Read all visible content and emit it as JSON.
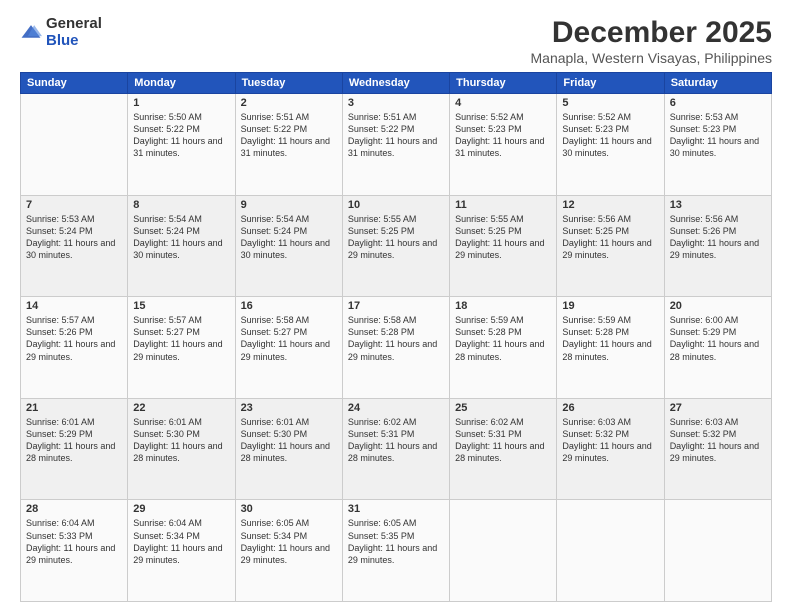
{
  "logo": {
    "general": "General",
    "blue": "Blue"
  },
  "title": {
    "month_year": "December 2025",
    "location": "Manapla, Western Visayas, Philippines"
  },
  "days_of_week": [
    "Sunday",
    "Monday",
    "Tuesday",
    "Wednesday",
    "Thursday",
    "Friday",
    "Saturday"
  ],
  "weeks": [
    [
      {
        "day": "",
        "sunrise": "",
        "sunset": "",
        "daylight": ""
      },
      {
        "day": "1",
        "sunrise": "Sunrise: 5:50 AM",
        "sunset": "Sunset: 5:22 PM",
        "daylight": "Daylight: 11 hours and 31 minutes."
      },
      {
        "day": "2",
        "sunrise": "Sunrise: 5:51 AM",
        "sunset": "Sunset: 5:22 PM",
        "daylight": "Daylight: 11 hours and 31 minutes."
      },
      {
        "day": "3",
        "sunrise": "Sunrise: 5:51 AM",
        "sunset": "Sunset: 5:22 PM",
        "daylight": "Daylight: 11 hours and 31 minutes."
      },
      {
        "day": "4",
        "sunrise": "Sunrise: 5:52 AM",
        "sunset": "Sunset: 5:23 PM",
        "daylight": "Daylight: 11 hours and 31 minutes."
      },
      {
        "day": "5",
        "sunrise": "Sunrise: 5:52 AM",
        "sunset": "Sunset: 5:23 PM",
        "daylight": "Daylight: 11 hours and 30 minutes."
      },
      {
        "day": "6",
        "sunrise": "Sunrise: 5:53 AM",
        "sunset": "Sunset: 5:23 PM",
        "daylight": "Daylight: 11 hours and 30 minutes."
      }
    ],
    [
      {
        "day": "7",
        "sunrise": "Sunrise: 5:53 AM",
        "sunset": "Sunset: 5:24 PM",
        "daylight": "Daylight: 11 hours and 30 minutes."
      },
      {
        "day": "8",
        "sunrise": "Sunrise: 5:54 AM",
        "sunset": "Sunset: 5:24 PM",
        "daylight": "Daylight: 11 hours and 30 minutes."
      },
      {
        "day": "9",
        "sunrise": "Sunrise: 5:54 AM",
        "sunset": "Sunset: 5:24 PM",
        "daylight": "Daylight: 11 hours and 30 minutes."
      },
      {
        "day": "10",
        "sunrise": "Sunrise: 5:55 AM",
        "sunset": "Sunset: 5:25 PM",
        "daylight": "Daylight: 11 hours and 29 minutes."
      },
      {
        "day": "11",
        "sunrise": "Sunrise: 5:55 AM",
        "sunset": "Sunset: 5:25 PM",
        "daylight": "Daylight: 11 hours and 29 minutes."
      },
      {
        "day": "12",
        "sunrise": "Sunrise: 5:56 AM",
        "sunset": "Sunset: 5:25 PM",
        "daylight": "Daylight: 11 hours and 29 minutes."
      },
      {
        "day": "13",
        "sunrise": "Sunrise: 5:56 AM",
        "sunset": "Sunset: 5:26 PM",
        "daylight": "Daylight: 11 hours and 29 minutes."
      }
    ],
    [
      {
        "day": "14",
        "sunrise": "Sunrise: 5:57 AM",
        "sunset": "Sunset: 5:26 PM",
        "daylight": "Daylight: 11 hours and 29 minutes."
      },
      {
        "day": "15",
        "sunrise": "Sunrise: 5:57 AM",
        "sunset": "Sunset: 5:27 PM",
        "daylight": "Daylight: 11 hours and 29 minutes."
      },
      {
        "day": "16",
        "sunrise": "Sunrise: 5:58 AM",
        "sunset": "Sunset: 5:27 PM",
        "daylight": "Daylight: 11 hours and 29 minutes."
      },
      {
        "day": "17",
        "sunrise": "Sunrise: 5:58 AM",
        "sunset": "Sunset: 5:28 PM",
        "daylight": "Daylight: 11 hours and 29 minutes."
      },
      {
        "day": "18",
        "sunrise": "Sunrise: 5:59 AM",
        "sunset": "Sunset: 5:28 PM",
        "daylight": "Daylight: 11 hours and 28 minutes."
      },
      {
        "day": "19",
        "sunrise": "Sunrise: 5:59 AM",
        "sunset": "Sunset: 5:28 PM",
        "daylight": "Daylight: 11 hours and 28 minutes."
      },
      {
        "day": "20",
        "sunrise": "Sunrise: 6:00 AM",
        "sunset": "Sunset: 5:29 PM",
        "daylight": "Daylight: 11 hours and 28 minutes."
      }
    ],
    [
      {
        "day": "21",
        "sunrise": "Sunrise: 6:01 AM",
        "sunset": "Sunset: 5:29 PM",
        "daylight": "Daylight: 11 hours and 28 minutes."
      },
      {
        "day": "22",
        "sunrise": "Sunrise: 6:01 AM",
        "sunset": "Sunset: 5:30 PM",
        "daylight": "Daylight: 11 hours and 28 minutes."
      },
      {
        "day": "23",
        "sunrise": "Sunrise: 6:01 AM",
        "sunset": "Sunset: 5:30 PM",
        "daylight": "Daylight: 11 hours and 28 minutes."
      },
      {
        "day": "24",
        "sunrise": "Sunrise: 6:02 AM",
        "sunset": "Sunset: 5:31 PM",
        "daylight": "Daylight: 11 hours and 28 minutes."
      },
      {
        "day": "25",
        "sunrise": "Sunrise: 6:02 AM",
        "sunset": "Sunset: 5:31 PM",
        "daylight": "Daylight: 11 hours and 28 minutes."
      },
      {
        "day": "26",
        "sunrise": "Sunrise: 6:03 AM",
        "sunset": "Sunset: 5:32 PM",
        "daylight": "Daylight: 11 hours and 29 minutes."
      },
      {
        "day": "27",
        "sunrise": "Sunrise: 6:03 AM",
        "sunset": "Sunset: 5:32 PM",
        "daylight": "Daylight: 11 hours and 29 minutes."
      }
    ],
    [
      {
        "day": "28",
        "sunrise": "Sunrise: 6:04 AM",
        "sunset": "Sunset: 5:33 PM",
        "daylight": "Daylight: 11 hours and 29 minutes."
      },
      {
        "day": "29",
        "sunrise": "Sunrise: 6:04 AM",
        "sunset": "Sunset: 5:34 PM",
        "daylight": "Daylight: 11 hours and 29 minutes."
      },
      {
        "day": "30",
        "sunrise": "Sunrise: 6:05 AM",
        "sunset": "Sunset: 5:34 PM",
        "daylight": "Daylight: 11 hours and 29 minutes."
      },
      {
        "day": "31",
        "sunrise": "Sunrise: 6:05 AM",
        "sunset": "Sunset: 5:35 PM",
        "daylight": "Daylight: 11 hours and 29 minutes."
      },
      {
        "day": "",
        "sunrise": "",
        "sunset": "",
        "daylight": ""
      },
      {
        "day": "",
        "sunrise": "",
        "sunset": "",
        "daylight": ""
      },
      {
        "day": "",
        "sunrise": "",
        "sunset": "",
        "daylight": ""
      }
    ]
  ]
}
